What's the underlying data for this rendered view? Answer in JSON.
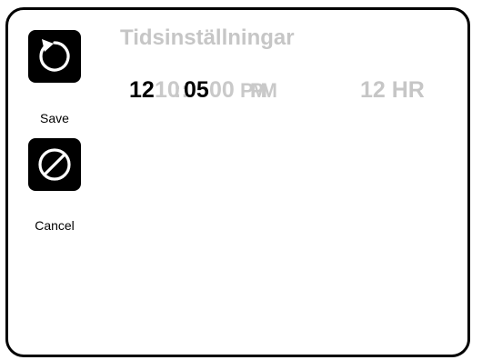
{
  "title": "Tidsinställningar",
  "buttons": {
    "save_label": "Save",
    "cancel_label": "Cancel"
  },
  "time": {
    "hour": "12",
    "hour_ghost": "10",
    "separator": "::",
    "minute": "05",
    "minute_ghost": "00",
    "ampm": "PM",
    "ampm_ghost": "PM",
    "format": "12 HR"
  },
  "icons": {
    "save": "rotate-ccw-icon",
    "cancel": "prohibited-icon"
  },
  "colors": {
    "button_bg": "#000000",
    "inactive_text": "#c6c6c6",
    "active_text": "#000000"
  }
}
